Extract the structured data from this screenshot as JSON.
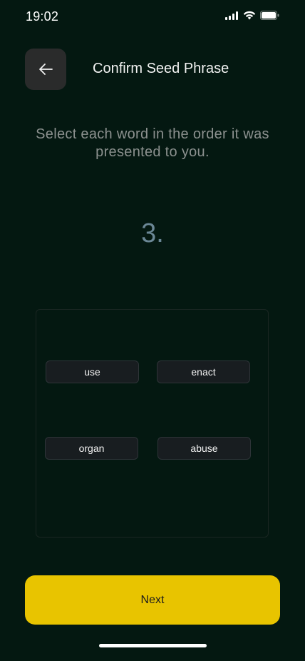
{
  "status_bar": {
    "time": "19:02",
    "icons": [
      "cellular-signal-icon",
      "wifi-icon",
      "battery-icon"
    ]
  },
  "header": {
    "back_icon": "arrow-left-icon",
    "title": "Confirm Seed Phrase"
  },
  "instruction": "Select each word in the order it was presented to you.",
  "step_number": "3.",
  "word_options": [
    "use",
    "enact",
    "organ",
    "abuse"
  ],
  "next_button_label": "Next",
  "colors": {
    "background": "#041811",
    "accent": "#e8c400",
    "chip_background": "#181d20",
    "step_number": "#6b8796"
  }
}
